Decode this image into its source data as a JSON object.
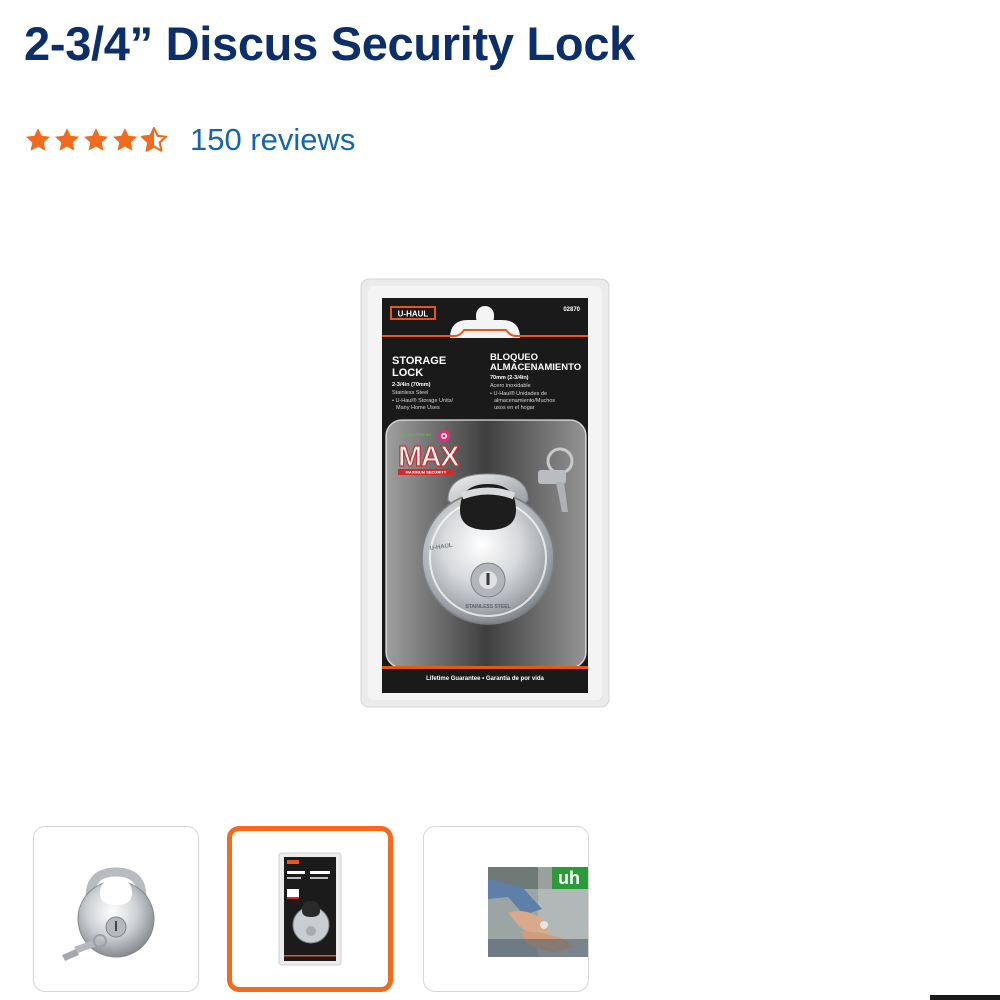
{
  "product": {
    "title": "2-3/4” Discus Security Lock",
    "rating_value": 4.5,
    "rating_max": 5,
    "reviews_label": "150 reviews"
  },
  "package": {
    "brand": "U-HAUL",
    "sku": "02870",
    "title_en": "STORAGE LOCK",
    "size_en": "2-3/4in (70mm)",
    "material_en": "Stainless Steel",
    "use_en": "U-Haul® Storage Units/ Many Home Uses",
    "title_es": "BLOQUEO ALMACENAMIENTO",
    "size_es": "70mm (2-3/4in)",
    "material_es": "Acero inoxidable",
    "use_es": "U-Haul® Unidades de almacenamiento/Muchos usos en el hogar",
    "badge_top": "PROTECTED BY",
    "badge_main": "MAX",
    "badge_sub": "MAXIMUM SECURITY",
    "lock_engraving": "STAINLESS STEEL",
    "footer": "Lifetime Guarantee • Garantía de por vida"
  },
  "thumbnails": [
    {
      "label": "lock-only",
      "selected": false
    },
    {
      "label": "lock-in-package",
      "selected": true
    },
    {
      "label": "video-hands",
      "selected": false,
      "sign_text": "uh"
    }
  ],
  "colors": {
    "title": "#0c2f6b",
    "star": "#f26a1b",
    "link": "#1565b0",
    "selected_border": "#f26a1b",
    "package_orange": "#e8561e"
  }
}
